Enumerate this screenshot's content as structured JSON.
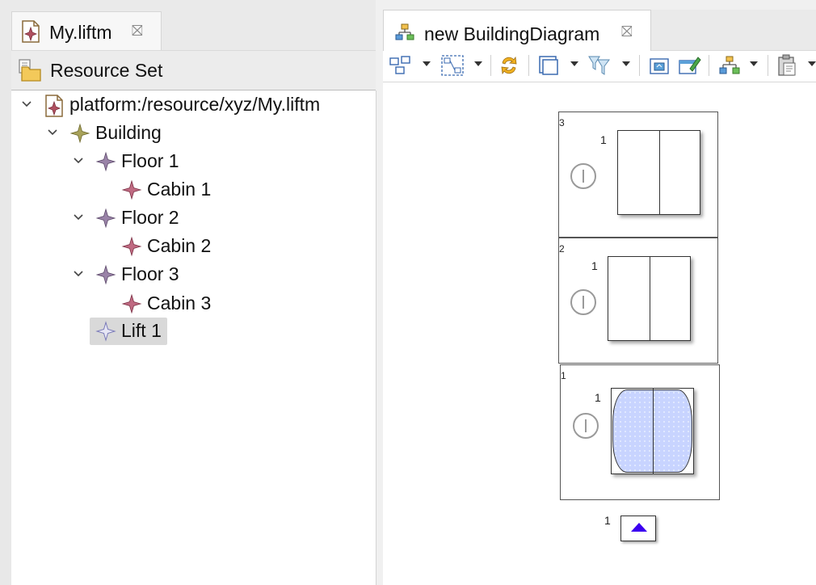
{
  "left_editor": {
    "tab": {
      "title": "My.liftm",
      "close": "⛝"
    },
    "header": {
      "label": "Resource Set"
    },
    "tree": [
      {
        "label": "platform:/resource/xyz/My.liftm",
        "icon": "model-file-icon"
      },
      {
        "label": "Building",
        "icon": "building-node-icon"
      },
      {
        "label": "Floor 1",
        "icon": "floor-node-icon"
      },
      {
        "label": "Cabin 1",
        "icon": "cabin-node-icon"
      },
      {
        "label": "Floor 2",
        "icon": "floor-node-icon"
      },
      {
        "label": "Cabin 2",
        "icon": "cabin-node-icon"
      },
      {
        "label": "Floor 3",
        "icon": "floor-node-icon"
      },
      {
        "label": "Cabin 3",
        "icon": "cabin-node-icon"
      },
      {
        "label": "Lift 1",
        "icon": "lift-node-icon",
        "selected": true
      }
    ]
  },
  "right_editor": {
    "tab": {
      "title": "new BuildingDiagram",
      "close": "⛝"
    },
    "toolbar": [
      "select-all-icon",
      "arrange-icon",
      "refresh-icon",
      "layer-icon",
      "filter-icon",
      "export-image-icon",
      "edit-icon",
      "layout-icon",
      "paste-icon"
    ],
    "diagram": {
      "floors": [
        {
          "floor_label": "3",
          "cabin_label": "1",
          "door_open": false
        },
        {
          "floor_label": "2",
          "cabin_label": "1",
          "door_open": false
        },
        {
          "floor_label": "1",
          "cabin_label": "1",
          "door_open": true
        }
      ],
      "lift": {
        "label": "1",
        "direction": "up"
      }
    }
  },
  "colors": {
    "selection": "#d9d9d9",
    "door_open_fill": "#c8d4ff",
    "lift_arrow": "#3b00f0",
    "node_purple": "#9b6b9b"
  }
}
